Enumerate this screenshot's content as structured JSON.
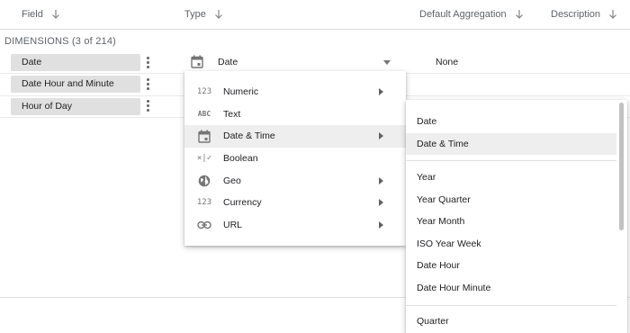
{
  "header": {
    "field": "Field",
    "type": "Type",
    "default_aggregation": "Default Aggregation",
    "description": "Description"
  },
  "dimensions": {
    "title": "DIMENSIONS (3 of 214)",
    "rows": [
      {
        "name": "Date"
      },
      {
        "name": "Date Hour and Minute"
      },
      {
        "name": "Hour of Day"
      }
    ]
  },
  "first_row": {
    "type_value": "Date",
    "aggregation": "None"
  },
  "type_menu": {
    "items": [
      {
        "icon": "numeric-icon",
        "icon_text": "123",
        "label": "Numeric",
        "has_submenu": true
      },
      {
        "icon": "text-icon",
        "icon_text": "ABC",
        "label": "Text",
        "has_submenu": false
      },
      {
        "icon": "calendar-icon",
        "icon_text": "",
        "label": "Date & Time",
        "has_submenu": true,
        "highlighted": true
      },
      {
        "icon": "boolean-icon",
        "icon_text": "×|✓",
        "label": "Boolean",
        "has_submenu": false
      },
      {
        "icon": "globe-icon",
        "icon_text": "",
        "label": "Geo",
        "has_submenu": true
      },
      {
        "icon": "currency-icon",
        "icon_text": "123",
        "label": "Currency",
        "has_submenu": true
      },
      {
        "icon": "link-icon",
        "icon_text": "",
        "label": "URL",
        "has_submenu": true
      }
    ]
  },
  "datetime_submenu": {
    "items": [
      {
        "label": "Date"
      },
      {
        "label": "Date & Time",
        "highlighted": true
      },
      {
        "label": "Year"
      },
      {
        "label": "Year Quarter"
      },
      {
        "label": "Year Month"
      },
      {
        "label": "ISO Year Week"
      },
      {
        "label": "Date Hour"
      },
      {
        "label": "Date Hour Minute"
      },
      {
        "label": "Quarter"
      }
    ]
  },
  "colors": {
    "highlight": "#eeeeee",
    "chip": "#e0e0e0",
    "icon": "#757575"
  }
}
